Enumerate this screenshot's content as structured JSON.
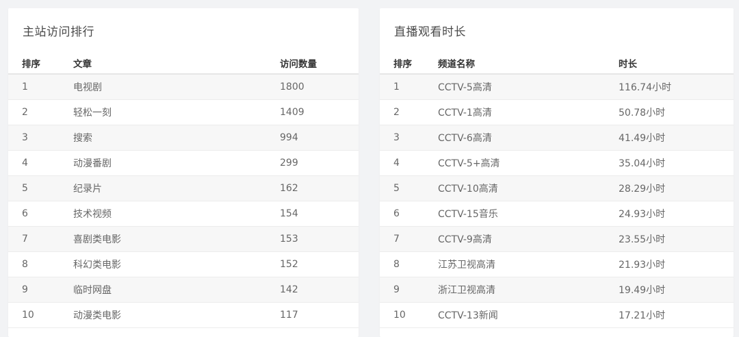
{
  "left": {
    "title": "主站访问排行",
    "headers": [
      "排序",
      "文章",
      "访问数量"
    ],
    "rows": [
      [
        "1",
        "电视剧",
        "1800"
      ],
      [
        "2",
        "轻松一刻",
        "1409"
      ],
      [
        "3",
        "搜索",
        "994"
      ],
      [
        "4",
        "动漫番剧",
        "299"
      ],
      [
        "5",
        "纪录片",
        "162"
      ],
      [
        "6",
        "技术视频",
        "154"
      ],
      [
        "7",
        "喜剧类电影",
        "153"
      ],
      [
        "8",
        "科幻类电影",
        "152"
      ],
      [
        "9",
        "临时网盘",
        "142"
      ],
      [
        "10",
        "动漫类电影",
        "117"
      ]
    ]
  },
  "right": {
    "title": "直播观看时长",
    "headers": [
      "排序",
      "频道名称",
      "时长"
    ],
    "rows": [
      [
        "1",
        "CCTV-5高清",
        "116.74小时"
      ],
      [
        "2",
        "CCTV-1高清",
        "50.78小时"
      ],
      [
        "3",
        "CCTV-6高清",
        "41.49小时"
      ],
      [
        "4",
        "CCTV-5+高清",
        "35.04小时"
      ],
      [
        "5",
        "CCTV-10高清",
        "28.29小时"
      ],
      [
        "6",
        "CCTV-15音乐",
        "24.93小时"
      ],
      [
        "7",
        "CCTV-9高清",
        "23.55小时"
      ],
      [
        "8",
        "江苏卫视高清",
        "21.93小时"
      ],
      [
        "9",
        "浙江卫视高清",
        "19.49小时"
      ],
      [
        "10",
        "CCTV-13新闻",
        "17.21小时"
      ]
    ]
  }
}
